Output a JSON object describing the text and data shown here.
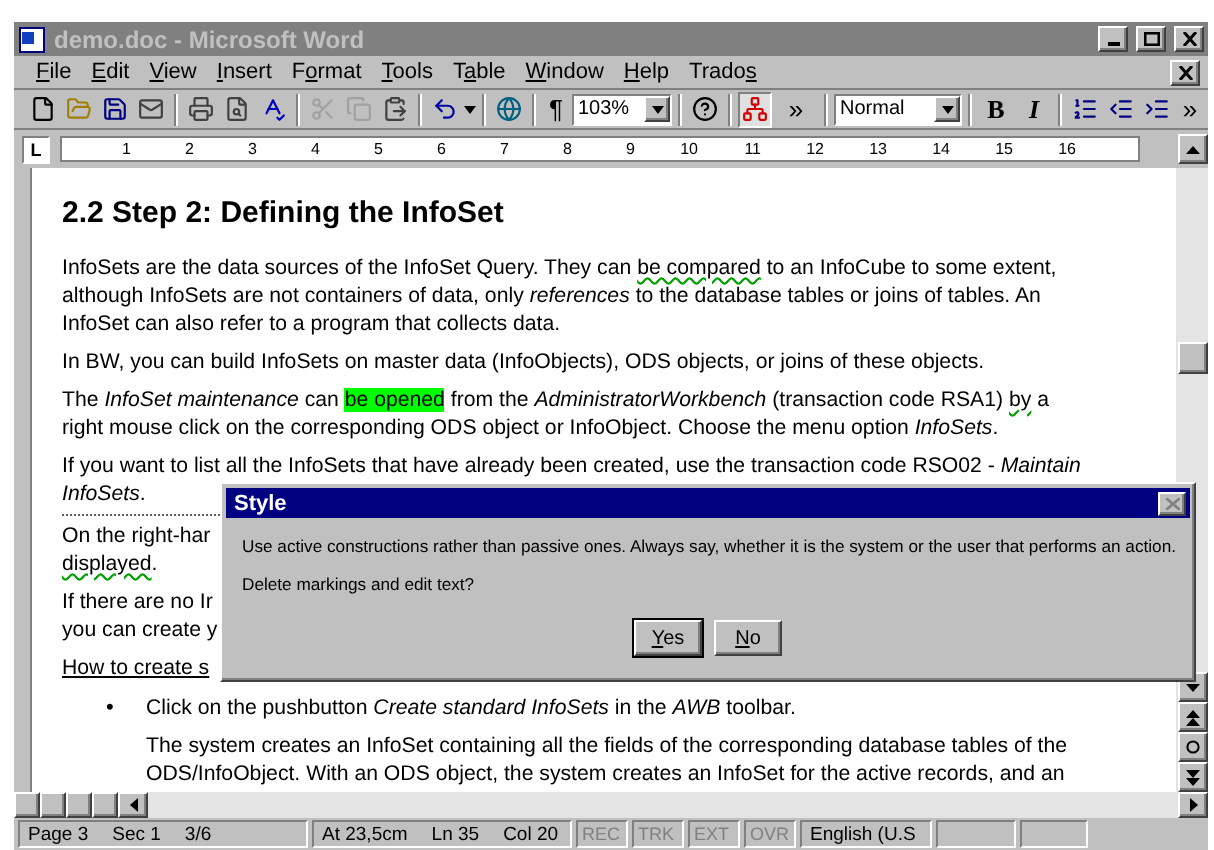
{
  "window": {
    "title": "demo.doc - Microsoft Word",
    "active": false
  },
  "menu": [
    {
      "key": "F",
      "after": "ile"
    },
    {
      "key": "E",
      "after": "dit"
    },
    {
      "key": "V",
      "after": "iew"
    },
    {
      "key": "I",
      "after": "nsert"
    },
    {
      "before": "F",
      "key": "o",
      "after": "rmat"
    },
    {
      "key": "T",
      "after": "ools"
    },
    {
      "before": "T",
      "key": "a",
      "after": "ble"
    },
    {
      "key": "W",
      "after": "indow"
    },
    {
      "key": "H",
      "after": "elp"
    },
    {
      "before": "Trado",
      "key": "s"
    }
  ],
  "toolbar": {
    "pilcrow": "¶",
    "zoom": "103%",
    "more_1": "»",
    "style": "Normal",
    "bold": "B",
    "italic": "I",
    "more_2": "»",
    "cut": {
      "disabled": true
    },
    "copy": {
      "disabled": true
    },
    "trados": {
      "selected": true
    }
  },
  "ruler": {
    "tab_marker": "L",
    "marks": [
      "1",
      "2",
      "3",
      "4",
      "5",
      "6",
      "7",
      "8",
      "9",
      "10",
      "11",
      "12",
      "13",
      "14",
      "15",
      "16"
    ]
  },
  "document": {
    "heading": "2.2 Step 2: Defining the InfoSet",
    "paragraphs": [
      {
        "kind": "text",
        "lines": [
          [
            {
              "kind": "plain",
              "text": "InfoSets are the data sources of the InfoSet Query. They can "
            },
            {
              "kind": "wavy",
              "text": "be compared"
            },
            {
              "kind": "plain",
              "text": " to an InfoCube to some extent,"
            }
          ],
          [
            {
              "kind": "plain",
              "text": "although InfoSets are not containers of data, only "
            },
            {
              "kind": "italic",
              "text": "references"
            },
            {
              "kind": "plain",
              "text": " to the database tables or joins of tables. An"
            }
          ],
          [
            {
              "kind": "plain",
              "text": "InfoSet can also refer to a program that collects data."
            }
          ]
        ]
      },
      {
        "kind": "text",
        "lines": [
          [
            {
              "kind": "plain",
              "text": "In BW, you can build InfoSets on master data (InfoObjects), ODS objects, or joins of these objects."
            }
          ]
        ]
      },
      {
        "kind": "text",
        "lines": [
          [
            {
              "kind": "plain",
              "text": "The "
            },
            {
              "kind": "italic",
              "text": "InfoSet maintenance"
            },
            {
              "kind": "plain",
              "text": " can "
            },
            {
              "kind": "highlight",
              "text": "be opened"
            },
            {
              "kind": "plain",
              "text": " from the "
            },
            {
              "kind": "italic",
              "text": "AdministratorWorkbench"
            },
            {
              "kind": "plain",
              "text": " (transaction code RSA1) "
            },
            {
              "kind": "wavy",
              "text": "by"
            },
            {
              "kind": "plain",
              "text": " a"
            }
          ],
          [
            {
              "kind": "plain",
              "text": "right mouse click on the corresponding ODS object or InfoObject. Choose the menu option "
            },
            {
              "kind": "italic",
              "text": "InfoSets"
            },
            {
              "kind": "plain",
              "text": "."
            }
          ]
        ]
      },
      {
        "kind": "break",
        "lines": [
          [
            {
              "kind": "plain",
              "text": "If you want to list all the InfoSets that have already been created, use the transaction code RSO02 - "
            },
            {
              "kind": "italic",
              "text": "Maintain"
            }
          ],
          [
            {
              "kind": "italic",
              "text": "InfoSets"
            },
            {
              "kind": "plain",
              "text": "."
            }
          ]
        ]
      },
      {
        "kind": "text",
        "lines": [
          [
            {
              "kind": "plain",
              "text": "On the right-har"
            }
          ],
          [
            {
              "kind": "wavy",
              "text": "displayed"
            },
            {
              "kind": "plain",
              "text": "."
            }
          ]
        ]
      },
      {
        "kind": "text",
        "lines": [
          [
            {
              "kind": "plain",
              "text": "If there are no Ir"
            }
          ],
          [
            {
              "kind": "plain",
              "text": "you can create y"
            }
          ]
        ]
      },
      {
        "kind": "link",
        "lines": [
          [
            {
              "kind": "plain",
              "text": "How to create s"
            }
          ]
        ]
      },
      {
        "kind": "bullet",
        "bullet": "•",
        "lines": [
          [
            {
              "kind": "plain",
              "text": "Click on the pushbutton "
            },
            {
              "kind": "italic",
              "text": "Create standard InfoSets"
            },
            {
              "kind": "plain",
              "text": " in the "
            },
            {
              "kind": "italic",
              "text": "AWB"
            },
            {
              "kind": "plain",
              "text": " toolbar."
            }
          ]
        ]
      },
      {
        "kind": "indented",
        "lines": [
          [
            {
              "kind": "plain",
              "text": "The system creates an InfoSet containing all the fields of the corresponding database tables of the"
            }
          ],
          [
            {
              "kind": "plain",
              "text": "ODS/InfoObject. With an ODS object, the system creates an InfoSet for the active records, and an"
            }
          ]
        ]
      }
    ]
  },
  "dialog": {
    "title": "Style",
    "close_disabled": true,
    "message": "Use active constructions rather than passive ones. Always say, whether it is the system or the user that performs an action.",
    "question": "Delete markings and edit text?",
    "buttons": [
      {
        "key": "Y",
        "after": "es",
        "default": true
      },
      {
        "key": "N",
        "after": "o",
        "default": false
      }
    ]
  },
  "status_bar": {
    "groups": [
      [
        "Page 3",
        "Sec 1",
        "3/6"
      ],
      [
        "At 23,5cm",
        "Ln 35",
        "Col 20"
      ]
    ],
    "indicators": [
      {
        "label": "REC",
        "on": false
      },
      {
        "label": "TRK",
        "on": false
      },
      {
        "label": "EXT",
        "on": false
      },
      {
        "label": "OVR",
        "on": false
      }
    ],
    "language": "English (U.S"
  }
}
